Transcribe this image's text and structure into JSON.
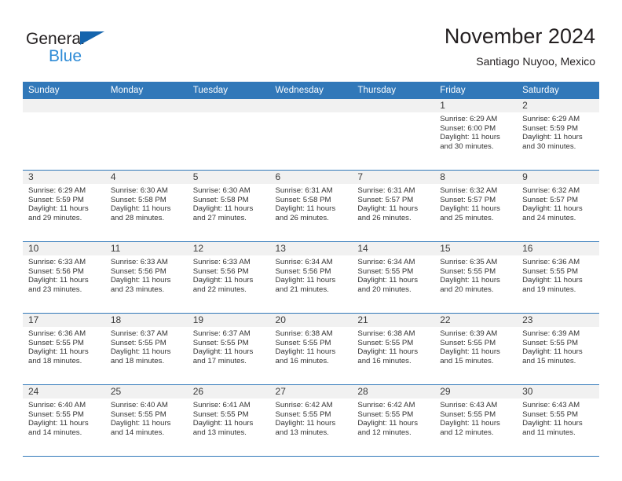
{
  "brand": {
    "line1": "General",
    "line2": "Blue",
    "triangle_color": "#1464ad",
    "blue_text_color": "#2e8bd6"
  },
  "header": {
    "title": "November 2024",
    "subtitle": "Santiago Nuyoo, Mexico"
  },
  "theme": {
    "header_blue": "#3178b9",
    "daynum_band": "#f1f1f1",
    "text": "#231f20"
  },
  "weekdays": [
    "Sunday",
    "Monday",
    "Tuesday",
    "Wednesday",
    "Thursday",
    "Friday",
    "Saturday"
  ],
  "weeks": [
    [
      {
        "day": "",
        "empty": true
      },
      {
        "day": "",
        "empty": true
      },
      {
        "day": "",
        "empty": true
      },
      {
        "day": "",
        "empty": true
      },
      {
        "day": "",
        "empty": true
      },
      {
        "day": "1",
        "sunrise": "Sunrise: 6:29 AM",
        "sunset": "Sunset: 6:00 PM",
        "daylight": "Daylight: 11 hours and 30 minutes."
      },
      {
        "day": "2",
        "sunrise": "Sunrise: 6:29 AM",
        "sunset": "Sunset: 5:59 PM",
        "daylight": "Daylight: 11 hours and 30 minutes."
      }
    ],
    [
      {
        "day": "3",
        "sunrise": "Sunrise: 6:29 AM",
        "sunset": "Sunset: 5:59 PM",
        "daylight": "Daylight: 11 hours and 29 minutes."
      },
      {
        "day": "4",
        "sunrise": "Sunrise: 6:30 AM",
        "sunset": "Sunset: 5:58 PM",
        "daylight": "Daylight: 11 hours and 28 minutes."
      },
      {
        "day": "5",
        "sunrise": "Sunrise: 6:30 AM",
        "sunset": "Sunset: 5:58 PM",
        "daylight": "Daylight: 11 hours and 27 minutes."
      },
      {
        "day": "6",
        "sunrise": "Sunrise: 6:31 AM",
        "sunset": "Sunset: 5:58 PM",
        "daylight": "Daylight: 11 hours and 26 minutes."
      },
      {
        "day": "7",
        "sunrise": "Sunrise: 6:31 AM",
        "sunset": "Sunset: 5:57 PM",
        "daylight": "Daylight: 11 hours and 26 minutes."
      },
      {
        "day": "8",
        "sunrise": "Sunrise: 6:32 AM",
        "sunset": "Sunset: 5:57 PM",
        "daylight": "Daylight: 11 hours and 25 minutes."
      },
      {
        "day": "9",
        "sunrise": "Sunrise: 6:32 AM",
        "sunset": "Sunset: 5:57 PM",
        "daylight": "Daylight: 11 hours and 24 minutes."
      }
    ],
    [
      {
        "day": "10",
        "sunrise": "Sunrise: 6:33 AM",
        "sunset": "Sunset: 5:56 PM",
        "daylight": "Daylight: 11 hours and 23 minutes."
      },
      {
        "day": "11",
        "sunrise": "Sunrise: 6:33 AM",
        "sunset": "Sunset: 5:56 PM",
        "daylight": "Daylight: 11 hours and 23 minutes."
      },
      {
        "day": "12",
        "sunrise": "Sunrise: 6:33 AM",
        "sunset": "Sunset: 5:56 PM",
        "daylight": "Daylight: 11 hours and 22 minutes."
      },
      {
        "day": "13",
        "sunrise": "Sunrise: 6:34 AM",
        "sunset": "Sunset: 5:56 PM",
        "daylight": "Daylight: 11 hours and 21 minutes."
      },
      {
        "day": "14",
        "sunrise": "Sunrise: 6:34 AM",
        "sunset": "Sunset: 5:55 PM",
        "daylight": "Daylight: 11 hours and 20 minutes."
      },
      {
        "day": "15",
        "sunrise": "Sunrise: 6:35 AM",
        "sunset": "Sunset: 5:55 PM",
        "daylight": "Daylight: 11 hours and 20 minutes."
      },
      {
        "day": "16",
        "sunrise": "Sunrise: 6:36 AM",
        "sunset": "Sunset: 5:55 PM",
        "daylight": "Daylight: 11 hours and 19 minutes."
      }
    ],
    [
      {
        "day": "17",
        "sunrise": "Sunrise: 6:36 AM",
        "sunset": "Sunset: 5:55 PM",
        "daylight": "Daylight: 11 hours and 18 minutes."
      },
      {
        "day": "18",
        "sunrise": "Sunrise: 6:37 AM",
        "sunset": "Sunset: 5:55 PM",
        "daylight": "Daylight: 11 hours and 18 minutes."
      },
      {
        "day": "19",
        "sunrise": "Sunrise: 6:37 AM",
        "sunset": "Sunset: 5:55 PM",
        "daylight": "Daylight: 11 hours and 17 minutes."
      },
      {
        "day": "20",
        "sunrise": "Sunrise: 6:38 AM",
        "sunset": "Sunset: 5:55 PM",
        "daylight": "Daylight: 11 hours and 16 minutes."
      },
      {
        "day": "21",
        "sunrise": "Sunrise: 6:38 AM",
        "sunset": "Sunset: 5:55 PM",
        "daylight": "Daylight: 11 hours and 16 minutes."
      },
      {
        "day": "22",
        "sunrise": "Sunrise: 6:39 AM",
        "sunset": "Sunset: 5:55 PM",
        "daylight": "Daylight: 11 hours and 15 minutes."
      },
      {
        "day": "23",
        "sunrise": "Sunrise: 6:39 AM",
        "sunset": "Sunset: 5:55 PM",
        "daylight": "Daylight: 11 hours and 15 minutes."
      }
    ],
    [
      {
        "day": "24",
        "sunrise": "Sunrise: 6:40 AM",
        "sunset": "Sunset: 5:55 PM",
        "daylight": "Daylight: 11 hours and 14 minutes."
      },
      {
        "day": "25",
        "sunrise": "Sunrise: 6:40 AM",
        "sunset": "Sunset: 5:55 PM",
        "daylight": "Daylight: 11 hours and 14 minutes."
      },
      {
        "day": "26",
        "sunrise": "Sunrise: 6:41 AM",
        "sunset": "Sunset: 5:55 PM",
        "daylight": "Daylight: 11 hours and 13 minutes."
      },
      {
        "day": "27",
        "sunrise": "Sunrise: 6:42 AM",
        "sunset": "Sunset: 5:55 PM",
        "daylight": "Daylight: 11 hours and 13 minutes."
      },
      {
        "day": "28",
        "sunrise": "Sunrise: 6:42 AM",
        "sunset": "Sunset: 5:55 PM",
        "daylight": "Daylight: 11 hours and 12 minutes."
      },
      {
        "day": "29",
        "sunrise": "Sunrise: 6:43 AM",
        "sunset": "Sunset: 5:55 PM",
        "daylight": "Daylight: 11 hours and 12 minutes."
      },
      {
        "day": "30",
        "sunrise": "Sunrise: 6:43 AM",
        "sunset": "Sunset: 5:55 PM",
        "daylight": "Daylight: 11 hours and 11 minutes."
      }
    ]
  ]
}
